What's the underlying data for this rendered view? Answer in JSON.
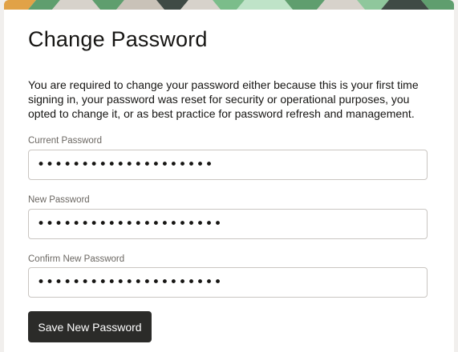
{
  "page": {
    "title": "Change Password",
    "intro": "You are required to change your password either because this is your first time signing in, your password was reset for security or operational purposes, you opted to change it, or as best practice for password refresh and management."
  },
  "form": {
    "current_password": {
      "label": "Current Password",
      "value": "********************"
    },
    "new_password": {
      "label": "New Password",
      "value": "*********************"
    },
    "confirm_password": {
      "label": "Confirm New Password",
      "value": "*********************"
    },
    "submit_label": "Save New Password"
  },
  "colors": {
    "page_background": "#f1efed",
    "card_background": "#ffffff",
    "primary_button": "#2b2b29",
    "banner_green": "#5f9e6e",
    "banner_orange": "#e1a247"
  }
}
